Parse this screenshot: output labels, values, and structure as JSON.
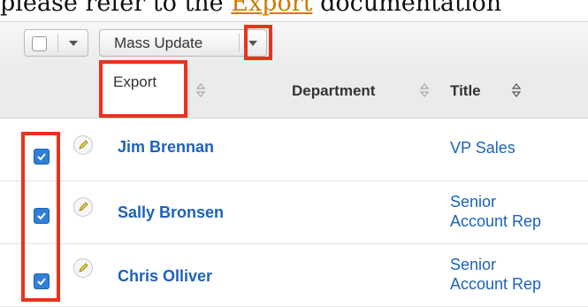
{
  "doc_text": {
    "before": "please refer to the ",
    "link": "Export",
    "after": " documentation"
  },
  "toolbar": {
    "mass_update_label": "Mass Update"
  },
  "menu": {
    "export_label": "Export"
  },
  "columns": {
    "department": "Department",
    "title": "Title"
  },
  "rows": [
    {
      "name": "Jim Brennan",
      "title_line1": "VP Sales",
      "title_line2": "",
      "checked": true
    },
    {
      "name": "Sally Bronsen",
      "title_line1": "Senior",
      "title_line2": "Account Rep",
      "checked": true
    },
    {
      "name": "Chris Olliver",
      "title_line1": "Senior",
      "title_line2": "Account Rep",
      "checked": true
    }
  ],
  "colors": {
    "link": "#1d62b8",
    "checkbox": "#2f7fd8",
    "highlight": "#e8331c"
  }
}
